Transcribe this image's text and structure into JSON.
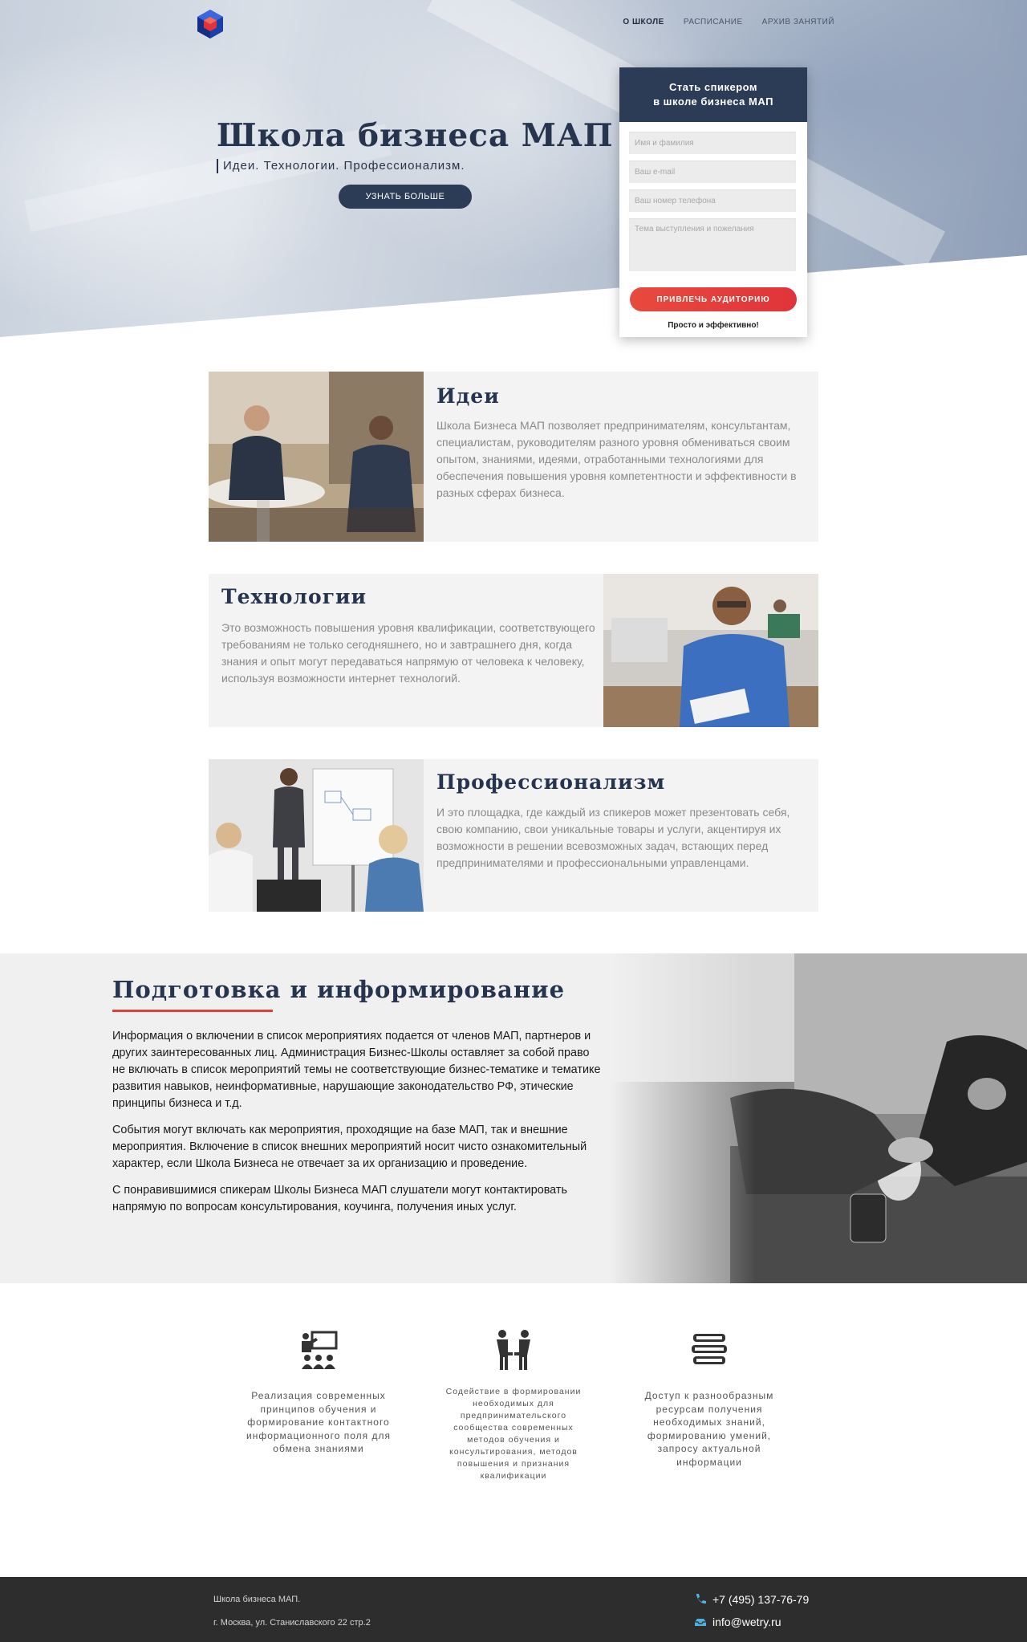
{
  "nav": {
    "items": [
      {
        "label": "О ШКОЛЕ",
        "active": true
      },
      {
        "label": "РАСПИСАНИЕ",
        "active": false
      },
      {
        "label": "АРХИВ ЗАНЯТИЙ",
        "active": false
      }
    ]
  },
  "hero": {
    "title": "Школа бизнеса МАП",
    "subtitle": "Идеи. Технологии. Профессионализм.",
    "button": "УЗНАТЬ БОЛЬШЕ"
  },
  "form": {
    "heading_line1": "Стать спикером",
    "heading_line2": "в школе бизнеса МАП",
    "name_placeholder": "Имя и фамилия",
    "email_placeholder": "Ваш e-mail",
    "phone_placeholder": "Ваш номер телефона",
    "topic_placeholder": "Тема выступления и пожелания",
    "submit": "ПРИВЛЕЧЬ АУДИТОРИЮ",
    "note": "Просто и эффективно!"
  },
  "cards": [
    {
      "title": "Идеи",
      "text": "Школа Бизнеса МАП позволяет предпринимателям, консультантам, специалистам, руководителям разного уровня обмениваться своим опытом, знаниями, идеями, отработанными технологиями для обеспечения повышения уровня компетентности и эффективности в разных сферах бизнеса."
    },
    {
      "title": "Технологии",
      "text": "Это возможность повышения уровня квалификации, соответствующего требованиям не только сегодняшнего, но и завтрашнего дня, когда знания и опыт могут передаваться напрямую от человека к человеку, используя возможности интернет технологий."
    },
    {
      "title": "Профессионализм",
      "text": "И это площадка, где каждый из спикеров может презентовать себя, свою компанию, свои уникальные товары и услуги, акцентируя их возможности в решении всевозможных задач, встающих перед предпринимателями и профессиональными управленцами."
    }
  ],
  "info": {
    "title": "Подготовка и информирование",
    "paragraphs": [
      "Информация о включении в список мероприятиях подается от членов МАП, партнеров и других заинтересованных лиц. Администрация Бизнес-Школы оставляет за собой право не включать в список мероприятий темы не соответствующие бизнес-тематике и тематике развития навыков, неинформативные, нарушающие законодательство РФ, этические принципы бизнеса и т.д.",
      "События могут включать как мероприятия, проходящие на базе МАП, так и внешние мероприятия. Включение в список внешних мероприятий носит чисто ознакомительный характер, если Школа Бизнеса не отвечает за их организацию и проведение.",
      "С понравившимися спикерам Школы Бизнеса МАП слушатели могут контактировать напрямую по вопросам консультирования, коучинга, получения иных услуг."
    ]
  },
  "features": [
    {
      "icon": "presentation-icon",
      "text": "Реализация современных принципов обучения и формирование контактного информационного поля для обмена знаниями"
    },
    {
      "icon": "handshake-icon",
      "text": "Содействие в формировании необходимых для предпринимательского сообщества современных методов обучения и консультирования, методов повышения и признания квалификации"
    },
    {
      "icon": "books-icon",
      "text": "Доступ к разнообразным ресурсам получения необходимых знаний, формированию умений, запросу актуальной информации"
    }
  ],
  "footer": {
    "name": "Школа бизнеса МАП.",
    "address": "г. Москва, ул. Станиславского 22 стр.2",
    "phone": "+7 (495) 137-76-79",
    "email": "info@wetry.ru"
  },
  "colors": {
    "navy": "#2c3b56",
    "title": "#27344d",
    "accent_red": "#e0403a",
    "footer_bg": "#2d2d2d"
  }
}
